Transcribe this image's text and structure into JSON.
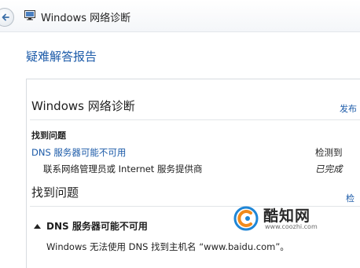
{
  "window": {
    "title": "Windows 网络诊断"
  },
  "report": {
    "heading": "疑难解答报告"
  },
  "diagnostics": {
    "title": "Windows 网络诊断",
    "publish_link": "发布"
  },
  "summary": {
    "section_label": "找到问题",
    "issue_label": "DNS 服务器可能不可用",
    "issue_status": "检测到",
    "action_label": "联系网络管理员或 Internet 服务提供商",
    "action_status": "已完成"
  },
  "details": {
    "section_title": "找到问题",
    "check_link": "检",
    "problem_title": "DNS 服务器可能不可用",
    "problem_description": "Windows 无法使用 DNS 找到主机名 “www.baidu.com”。"
  },
  "watermark": {
    "brand": "酷知网",
    "url": "www.coozhi.com"
  },
  "colors": {
    "link": "#1b5aa8",
    "text": "#1e1e1e",
    "watermark_blue": "#1f86d6",
    "watermark_orange": "#f08a1c"
  },
  "icons": {
    "back": "back-arrow-icon",
    "app": "network-diagnostics-icon",
    "collapse": "collapse-triangle-icon",
    "logo": "coozhi-logo-icon"
  }
}
